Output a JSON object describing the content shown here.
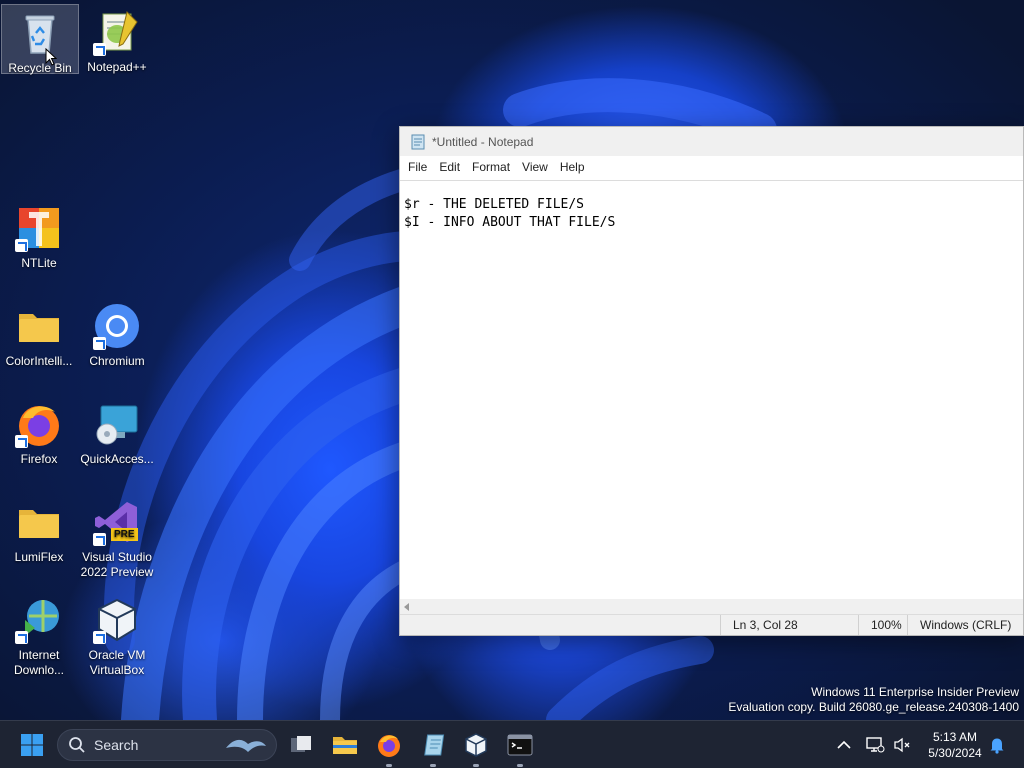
{
  "desktop": {
    "icons": [
      {
        "label": "Recycle Bin"
      },
      {
        "label": "Notepad++"
      },
      {
        "label": "NTLite"
      },
      {
        "label": "ColorIntelli..."
      },
      {
        "label": "Chromium"
      },
      {
        "label": "Firefox"
      },
      {
        "label": "QuickAcces..."
      },
      {
        "label": "LumiFlex"
      },
      {
        "label": "Visual Studio 2022 Preview",
        "badge": "PRE"
      },
      {
        "label": "Internet Downlo..."
      },
      {
        "label": "Oracle VM VirtualBox"
      }
    ]
  },
  "notepad": {
    "title": "*Untitled - Notepad",
    "menu": [
      "File",
      "Edit",
      "Format",
      "View",
      "Help"
    ],
    "content": "$r - THE DELETED FILE/S\n$I - INFO ABOUT THAT FILE/S",
    "status": {
      "position": "Ln 3, Col 28",
      "zoom": "100%",
      "line_ending": "Windows (CRLF)"
    }
  },
  "watermark": {
    "line1": "Windows 11 Enterprise Insider Preview",
    "line2": "Evaluation copy. Build 26080.ge_release.240308-1400"
  },
  "taskbar": {
    "search_placeholder": "Search",
    "clock": {
      "time": "5:13 AM",
      "date": "5/30/2024"
    }
  },
  "colors": {
    "taskbar_bg": "#1e2433",
    "accent_blue": "#1d6fe0",
    "folder_yellow": "#f5c84c"
  }
}
